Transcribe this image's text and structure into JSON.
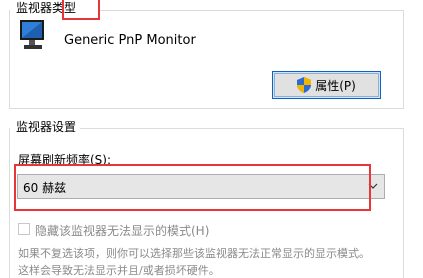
{
  "monitor_type": {
    "legend": "监视器类型",
    "monitor_name": "Generic PnP Monitor",
    "properties_button": "属性(P)"
  },
  "monitor_settings": {
    "legend": "监视器设置",
    "refresh_label": "屏幕刷新频率(S):",
    "refresh_value": "60 赫兹",
    "hide_modes_label": "隐藏该监视器无法显示的模式(H)",
    "description_line1": "如果不复选该项，则你可以选择那些该监视器无法正常显示的显示模式。",
    "description_line2": "这样会导致无法显示并且/或者损坏硬件。"
  },
  "colors": {
    "highlight": "#e8353a",
    "focus_border": "#0a64c8"
  },
  "icons": {
    "monitor": "monitor-icon",
    "shield": "uac-shield-icon",
    "dropdown": "chevron-down-icon"
  }
}
